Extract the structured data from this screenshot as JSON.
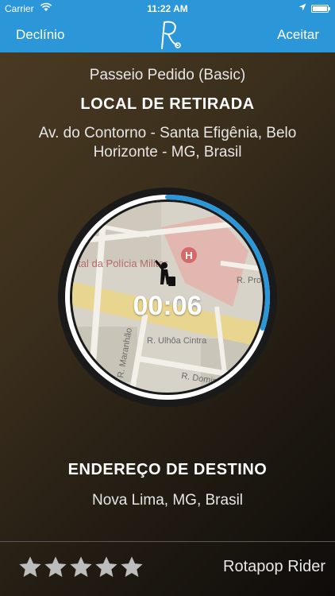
{
  "status_bar": {
    "carrier": "Carrier",
    "time": "11:22 AM"
  },
  "nav": {
    "decline_label": "Declínio",
    "accept_label": "Aceitar",
    "logo_icon": "rotapop-logo-icon"
  },
  "request": {
    "ride_type": "Passeio Pedido (Basic)",
    "pickup_title": "LOCAL DE RETIRADA",
    "pickup_address": "Av. do Contorno - Santa Efigênia, Belo Horizonte - MG, Brasil",
    "timer": "00:06",
    "timer_progress": 0.3,
    "map_labels": {
      "poi": "pital da Polícia Militar",
      "street1": "R. Prof.",
      "street2": "R. Ulhôa Cintra",
      "street3": "R. Maranhão",
      "street4": "R. Domingos"
    },
    "destination_title": "ENDEREÇO DE DESTINO",
    "destination_address": "Nova Lima, MG, Brasil"
  },
  "rider": {
    "name": "Rotapop Rider",
    "rating": 5
  },
  "colors": {
    "accent": "#2b97d8",
    "star": "#bdbdbd"
  }
}
